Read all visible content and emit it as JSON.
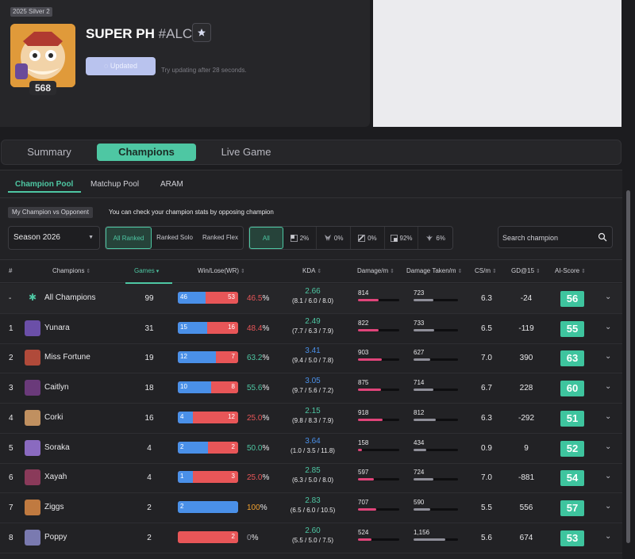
{
  "profile": {
    "season_tag": "2025 Silver 2",
    "level": "568",
    "name": "SUPER PH",
    "tag": "#ALC",
    "updated_label": "Updated",
    "update_hint": "Try updating after 28 seconds."
  },
  "main_tabs": [
    {
      "label": "Summary",
      "active": false
    },
    {
      "label": "Champions",
      "active": true
    },
    {
      "label": "Live Game",
      "active": false
    }
  ],
  "sub_tabs": [
    {
      "label": "Champion Pool",
      "active": true
    },
    {
      "label": "Matchup Pool",
      "active": false
    },
    {
      "label": "ARAM",
      "active": false
    }
  ],
  "info": {
    "pill": "My Champion vs Opponent",
    "text": "You can check your champion stats by opposing champion"
  },
  "filters": {
    "season": "Season 2026",
    "queues": [
      {
        "label": "All Ranked",
        "active": true
      },
      {
        "label": "Ranked Solo",
        "active": false
      },
      {
        "label": "Ranked Flex",
        "active": false
      }
    ],
    "positions": [
      {
        "icon": "all",
        "label": "All",
        "active": true
      },
      {
        "icon": "top-lane-icon",
        "label": "2%"
      },
      {
        "icon": "jungle-icon",
        "label": "0%"
      },
      {
        "icon": "mid-lane-icon",
        "label": "0%"
      },
      {
        "icon": "bot-lane-icon",
        "label": "92%"
      },
      {
        "icon": "support-icon",
        "label": "6%"
      }
    ],
    "search_placeholder": "Search champion"
  },
  "table": {
    "headers": {
      "rank": "#",
      "champions": "Champions",
      "games": "Games",
      "winlose": "Win/Lose(WR)",
      "kda": "KDA",
      "damage": "Damage/m",
      "taken": "Damage Taken/m",
      "cs": "CS/m",
      "gd": "GD@15",
      "ai": "AI-Score"
    },
    "rows": [
      {
        "rank": "-",
        "name": "All Champions",
        "games": "99",
        "wins": 46,
        "losses": 53,
        "wr": "46.5",
        "kda": "2.66",
        "kda_detail": "(8.1 / 6.0 / 8.0)",
        "dmg": "814",
        "dmg_frac": 0.5,
        "taken": "723",
        "taken_frac": 0.45,
        "cs": "6.3",
        "gd": "-24",
        "ai": "56",
        "wr_color": "#e85658",
        "kda_color": "#4ec7a3",
        "icon_color": ""
      },
      {
        "rank": "1",
        "name": "Yunara",
        "games": "31",
        "wins": 15,
        "losses": 16,
        "wr": "48.4",
        "kda": "2.49",
        "kda_detail": "(7.7 / 6.3 / 7.9)",
        "dmg": "822",
        "dmg_frac": 0.5,
        "taken": "733",
        "taken_frac": 0.46,
        "cs": "6.5",
        "gd": "-119",
        "ai": "55",
        "wr_color": "#e85658",
        "kda_color": "#4ec7a3",
        "icon_color": "#6b4fa8"
      },
      {
        "rank": "2",
        "name": "Miss Fortune",
        "games": "19",
        "wins": 12,
        "losses": 7,
        "wr": "63.2",
        "kda": "3.41",
        "kda_detail": "(9.4 / 5.0 / 7.8)",
        "dmg": "903",
        "dmg_frac": 0.58,
        "taken": "627",
        "taken_frac": 0.38,
        "cs": "7.0",
        "gd": "390",
        "ai": "63",
        "wr_color": "#4ec7a3",
        "kda_color": "#4a90e8",
        "icon_color": "#b04a3a"
      },
      {
        "rank": "3",
        "name": "Caitlyn",
        "games": "18",
        "wins": 10,
        "losses": 8,
        "wr": "55.6",
        "kda": "3.05",
        "kda_detail": "(9.7 / 5.6 / 7.2)",
        "dmg": "875",
        "dmg_frac": 0.55,
        "taken": "714",
        "taken_frac": 0.45,
        "cs": "6.7",
        "gd": "228",
        "ai": "60",
        "wr_color": "#4ec7a3",
        "kda_color": "#4a90e8",
        "icon_color": "#6a3a7a"
      },
      {
        "rank": "4",
        "name": "Corki",
        "games": "16",
        "wins": 4,
        "losses": 12,
        "wr": "25.0",
        "kda": "2.15",
        "kda_detail": "(9.8 / 8.3 / 7.9)",
        "dmg": "918",
        "dmg_frac": 0.6,
        "taken": "812",
        "taken_frac": 0.5,
        "cs": "6.3",
        "gd": "-292",
        "ai": "51",
        "wr_color": "#e85658",
        "kda_color": "#4ec7a3",
        "icon_color": "#c09060"
      },
      {
        "rank": "5",
        "name": "Soraka",
        "games": "4",
        "wins": 2,
        "losses": 2,
        "wr": "50.0",
        "kda": "3.64",
        "kda_detail": "(1.0 / 3.5 / 11.8)",
        "dmg": "158",
        "dmg_frac": 0.1,
        "taken": "434",
        "taken_frac": 0.28,
        "cs": "0.9",
        "gd": "9",
        "ai": "52",
        "wr_color": "#4ec7a3",
        "kda_color": "#4a90e8",
        "icon_color": "#8a6ac0"
      },
      {
        "rank": "6",
        "name": "Xayah",
        "games": "4",
        "wins": 1,
        "losses": 3,
        "wr": "25.0",
        "kda": "2.85",
        "kda_detail": "(6.3 / 5.0 / 8.0)",
        "dmg": "597",
        "dmg_frac": 0.38,
        "taken": "724",
        "taken_frac": 0.45,
        "cs": "7.0",
        "gd": "-881",
        "ai": "54",
        "wr_color": "#e85658",
        "kda_color": "#4ec7a3",
        "icon_color": "#8a3a5a"
      },
      {
        "rank": "7",
        "name": "Ziggs",
        "games": "2",
        "wins": 2,
        "losses": 0,
        "wr": "100",
        "kda": "2.83",
        "kda_detail": "(6.5 / 6.0 / 10.5)",
        "dmg": "707",
        "dmg_frac": 0.45,
        "taken": "590",
        "taken_frac": 0.37,
        "cs": "5.5",
        "gd": "556",
        "ai": "57",
        "wr_color": "#f0a030",
        "kda_color": "#4ec7a3",
        "icon_color": "#c07a40"
      },
      {
        "rank": "8",
        "name": "Poppy",
        "games": "2",
        "wins": 0,
        "losses": 2,
        "wr": "0",
        "kda": "2.60",
        "kda_detail": "(5.5 / 5.0 / 7.5)",
        "dmg": "524",
        "dmg_frac": 0.33,
        "taken": "1,156",
        "taken_frac": 0.72,
        "cs": "5.6",
        "gd": "674",
        "ai": "53",
        "wr_color": "#9a9aa2",
        "kda_color": "#4ec7a3",
        "icon_color": "#7a7ab0"
      }
    ]
  },
  "colors": {
    "accent": "#4ec7a3",
    "win": "#4a90e8",
    "loss": "#e85658"
  }
}
